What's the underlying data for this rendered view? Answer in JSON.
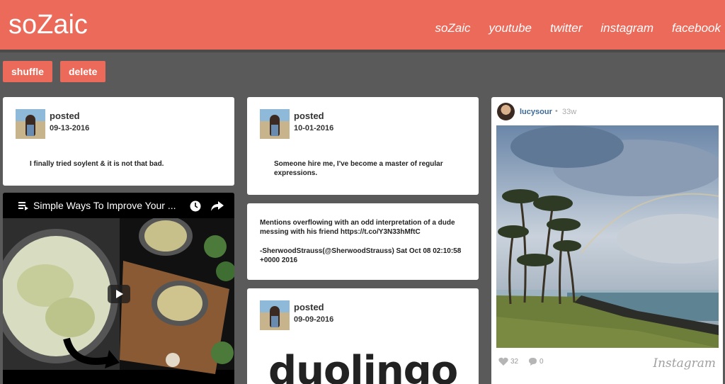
{
  "header": {
    "logo": "soZaic",
    "nav": [
      "soZaic",
      "youtube",
      "twitter",
      "instagram",
      "facebook"
    ]
  },
  "toolbar": {
    "shuffle_label": "shuffle",
    "delete_label": "delete"
  },
  "posts": [
    {
      "posted_label": "posted",
      "date": "09-13-2016",
      "message": "I finally tried soylent & it is not that bad."
    },
    {
      "posted_label": "posted",
      "date": "10-01-2016",
      "message": "Someone hire me, I've become a master of regular expressions."
    },
    {
      "posted_label": "posted",
      "date": "09-09-2016",
      "message": ""
    }
  ],
  "tweet": {
    "text": "Mentions overflowing with an odd interpretation of a dude messing with his friend https://t.co/Y3N33hMftC",
    "meta": "-SherwoodStrauss(@SherwoodStrauss) Sat Oct 08 02:10:58 +0000 2016"
  },
  "video": {
    "title": "Simple Ways To Improve Your ..."
  },
  "duolingo": {
    "logo_text": "duolingo"
  },
  "instagram": {
    "username": "lucysour",
    "time": "33w",
    "likes": "32",
    "comments": "0",
    "brand": "Instagram"
  },
  "colors": {
    "accent": "#ec6a5a",
    "background": "#5a5a5a"
  },
  "icons": [
    "playlist-icon",
    "clock-icon",
    "share-icon",
    "play-icon",
    "heart-icon",
    "comment-icon"
  ]
}
